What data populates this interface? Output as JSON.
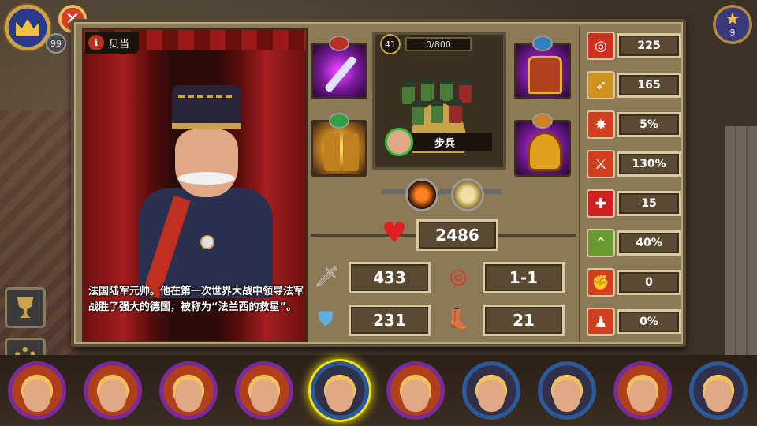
{
  "header": {
    "player_level": "99",
    "close_symbol": "✕",
    "star_count": "9"
  },
  "general": {
    "name": "贝当",
    "info_symbol": "i",
    "bio": "法国陆军元帅。他在第一次世界大战中领导法军战胜了强大的德国，被称为“法兰西的救星”。"
  },
  "unit": {
    "level": "41",
    "xp": "0/800",
    "type_label": "步兵"
  },
  "stats": {
    "hp": "2486",
    "attack": "433",
    "range": "1-1",
    "defense": "231",
    "speed": "21"
  },
  "right_stats": [
    {
      "icon": "target-icon",
      "value": "225",
      "color": "#d03020"
    },
    {
      "icon": "golden-arrow-icon",
      "value": "165",
      "color": "#d09020"
    },
    {
      "icon": "crit-burst-icon",
      "value": "5%",
      "color": "#d04020"
    },
    {
      "icon": "damage-up-icon",
      "value": "130%",
      "color": "#d04020"
    },
    {
      "icon": "heal-cross-icon",
      "value": "15",
      "color": "#d02020"
    },
    {
      "icon": "rank-chevron-icon",
      "value": "40%",
      "color": "#6a9a30"
    },
    {
      "icon": "flex-arm-icon",
      "value": "0",
      "color": "#d04020"
    },
    {
      "icon": "soldier-buff-icon",
      "value": "0%",
      "color": "#d04020"
    }
  ],
  "heroes": [
    {
      "name": "hero-1",
      "selected": false
    },
    {
      "name": "hero-2",
      "selected": false
    },
    {
      "name": "hero-3",
      "selected": false
    },
    {
      "name": "hero-4",
      "selected": false
    },
    {
      "name": "hero-5",
      "selected": true
    },
    {
      "name": "hero-6",
      "selected": false
    },
    {
      "name": "hero-7",
      "selected": false
    },
    {
      "name": "hero-8",
      "selected": false
    },
    {
      "name": "hero-9",
      "selected": false
    },
    {
      "name": "hero-10",
      "selected": false
    }
  ],
  "colors": {
    "panel": "#8b7a55",
    "accent_gold": "#c9a24a",
    "curtain_red": "#a51e1e",
    "selected_glow": "#f0e020"
  }
}
